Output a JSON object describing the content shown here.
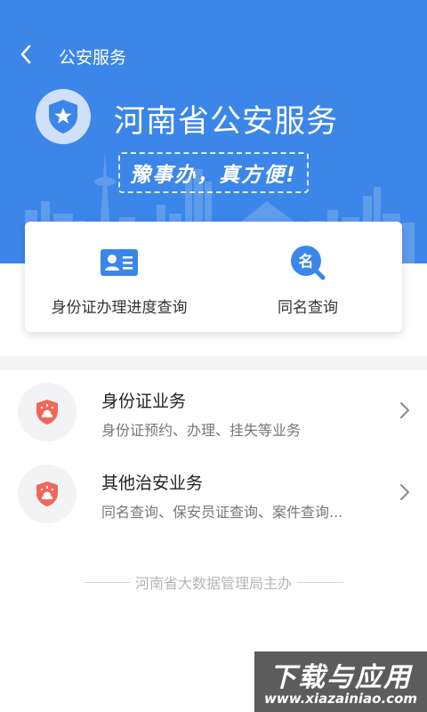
{
  "colors": {
    "primary_blue": "#3b86e8",
    "service_icon_red": "#f0675a",
    "card_icon_blue": "#3b86e8"
  },
  "header": {
    "back_icon": "chevron-left-icon",
    "title": "公安服务"
  },
  "hero": {
    "logo_icon": "police-badge-icon",
    "title": "河南省公安服务",
    "slogan": "豫事办，真方便!"
  },
  "quick_queries": [
    {
      "label": "身份证办理进度查询",
      "icon": "id-card-icon"
    },
    {
      "label": "同名查询",
      "icon": "name-search-icon"
    }
  ],
  "services": [
    {
      "title": "身份证业务",
      "desc": "身份证预约、办理、挂失等业务",
      "icon": "police-shield-icon"
    },
    {
      "title": "其他治安业务",
      "desc": "同名查询、保安员证查询、案件查询...",
      "icon": "police-shield-icon"
    }
  ],
  "footer": {
    "text": "河南省大数据管理局主办"
  },
  "watermark": {
    "title": "下载与应用",
    "url": "www.xiazainiao.com"
  }
}
